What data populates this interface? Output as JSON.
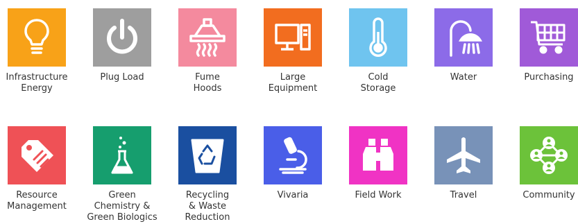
{
  "tiles": [
    {
      "label": "Infrastructure\nEnergy",
      "icon": "lightbulb-icon",
      "color": "#f8a218"
    },
    {
      "label": "Plug Load",
      "icon": "power-icon",
      "color": "#9e9e9e"
    },
    {
      "label": "Fume\nHoods",
      "icon": "fume-hood-icon",
      "color": "#f48a9e"
    },
    {
      "label": "Large\nEquipment",
      "icon": "computer-icon",
      "color": "#f26d1f"
    },
    {
      "label": "Cold\nStorage",
      "icon": "thermometer-icon",
      "color": "#6fc4ef"
    },
    {
      "label": "Water",
      "icon": "shower-icon",
      "color": "#8c6be8"
    },
    {
      "label": "Purchasing",
      "icon": "shopping-cart-icon",
      "color": "#a05ad8"
    },
    {
      "label": "Resource\nManagement",
      "icon": "tag-icon",
      "color": "#ef5156"
    },
    {
      "label": "Green\nChemistry &\nGreen Biologics",
      "icon": "flask-icon",
      "color": "#169e6e"
    },
    {
      "label": "Recycling\n& Waste\nReduction",
      "icon": "recycle-bin-icon",
      "color": "#1a4fa0"
    },
    {
      "label": "Vivaria",
      "icon": "microscope-icon",
      "color": "#4a5ee8"
    },
    {
      "label": "Field Work",
      "icon": "binoculars-icon",
      "color": "#f033c4"
    },
    {
      "label": "Travel",
      "icon": "airplane-icon",
      "color": "#7892b8"
    },
    {
      "label": "Community",
      "icon": "network-icon",
      "color": "#6cc23a"
    }
  ]
}
